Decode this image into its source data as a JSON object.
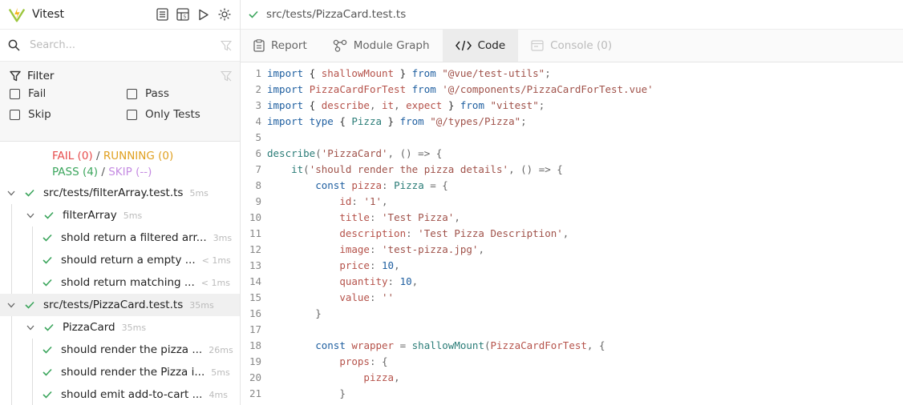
{
  "app": {
    "title": "Vitest"
  },
  "search": {
    "placeholder": "Search..."
  },
  "filter": {
    "title": "Filter",
    "options": [
      "Fail",
      "Pass",
      "Skip",
      "Only Tests"
    ]
  },
  "summary": {
    "fail": "FAIL (0)",
    "running": "RUNNING (0)",
    "pass": "PASS (4)",
    "skip": "SKIP (--)",
    "separator": "/"
  },
  "tree": [
    {
      "label": "src/tests/filterArray.test.ts",
      "duration": "5ms",
      "level": 0,
      "chevron": true
    },
    {
      "label": "filterArray",
      "duration": "5ms",
      "level": 1,
      "chevron": true
    },
    {
      "label": "shold return a filtered arr...",
      "duration": "3ms",
      "level": 2,
      "chevron": false
    },
    {
      "label": "should return a empty ...",
      "duration": "< 1ms",
      "level": 2,
      "chevron": false
    },
    {
      "label": "shold return matching ...",
      "duration": "< 1ms",
      "level": 2,
      "chevron": false
    },
    {
      "label": "src/tests/PizzaCard.test.ts",
      "duration": "35ms",
      "level": 0,
      "chevron": true,
      "active": true
    },
    {
      "label": "PizzaCard",
      "duration": "35ms",
      "level": 1,
      "chevron": true
    },
    {
      "label": "should render the pizza ...",
      "duration": "26ms",
      "level": 2,
      "chevron": false
    },
    {
      "label": "should render the Pizza i...",
      "duration": "5ms",
      "level": 2,
      "chevron": false
    },
    {
      "label": "should emit add-to-cart ...",
      "duration": "4ms",
      "level": 2,
      "chevron": false
    }
  ],
  "file": {
    "path": "src/tests/PizzaCard.test.ts"
  },
  "tabs": [
    {
      "label": "Report",
      "icon": "report-icon",
      "state": "normal"
    },
    {
      "label": "Module Graph",
      "icon": "graph-icon",
      "state": "normal"
    },
    {
      "label": "Code",
      "icon": "code-icon",
      "state": "active"
    },
    {
      "label": "Console (0)",
      "icon": "console-icon",
      "state": "disabled"
    }
  ],
  "code_lines": [
    [
      [
        "kw",
        "import"
      ],
      [
        "plain",
        " { "
      ],
      [
        "var",
        "shallowMount"
      ],
      [
        "plain",
        " } "
      ],
      [
        "kw",
        "from"
      ],
      [
        "plain",
        " "
      ],
      [
        "str",
        "\"@vue/test-utils\""
      ],
      [
        "pun",
        ";"
      ]
    ],
    [
      [
        "kw",
        "import"
      ],
      [
        "plain",
        " "
      ],
      [
        "var",
        "PizzaCardForTest"
      ],
      [
        "plain",
        " "
      ],
      [
        "kw",
        "from"
      ],
      [
        "plain",
        " "
      ],
      [
        "str",
        "'@/components/PizzaCardForTest.vue'"
      ]
    ],
    [
      [
        "kw",
        "import"
      ],
      [
        "plain",
        " { "
      ],
      [
        "var",
        "describe"
      ],
      [
        "pun",
        ", "
      ],
      [
        "var",
        "it"
      ],
      [
        "pun",
        ", "
      ],
      [
        "var",
        "expect"
      ],
      [
        "plain",
        " } "
      ],
      [
        "kw",
        "from"
      ],
      [
        "plain",
        " "
      ],
      [
        "str",
        "\"vitest\""
      ],
      [
        "pun",
        ";"
      ]
    ],
    [
      [
        "kw",
        "import"
      ],
      [
        "plain",
        " "
      ],
      [
        "kw",
        "type"
      ],
      [
        "plain",
        " { "
      ],
      [
        "typ",
        "Pizza"
      ],
      [
        "plain",
        " } "
      ],
      [
        "kw",
        "from"
      ],
      [
        "plain",
        " "
      ],
      [
        "str",
        "\"@/types/Pizza\""
      ],
      [
        "pun",
        ";"
      ]
    ],
    [],
    [
      [
        "fn",
        "describe"
      ],
      [
        "pun",
        "("
      ],
      [
        "str",
        "'PizzaCard'"
      ],
      [
        "pun",
        ", () => {"
      ]
    ],
    [
      [
        "plain",
        "    "
      ],
      [
        "fn",
        "it"
      ],
      [
        "pun",
        "("
      ],
      [
        "str",
        "'should render the pizza details'"
      ],
      [
        "pun",
        ", () => {"
      ]
    ],
    [
      [
        "plain",
        "        "
      ],
      [
        "kw",
        "const"
      ],
      [
        "plain",
        " "
      ],
      [
        "var",
        "pizza"
      ],
      [
        "pun",
        ": "
      ],
      [
        "typ",
        "Pizza"
      ],
      [
        "pun",
        " = {"
      ]
    ],
    [
      [
        "plain",
        "            "
      ],
      [
        "prop",
        "id"
      ],
      [
        "pun",
        ": "
      ],
      [
        "str",
        "'1'"
      ],
      [
        "pun",
        ","
      ]
    ],
    [
      [
        "plain",
        "            "
      ],
      [
        "prop",
        "title"
      ],
      [
        "pun",
        ": "
      ],
      [
        "str",
        "'Test Pizza'"
      ],
      [
        "pun",
        ","
      ]
    ],
    [
      [
        "plain",
        "            "
      ],
      [
        "prop",
        "description"
      ],
      [
        "pun",
        ": "
      ],
      [
        "str",
        "'Test Pizza Description'"
      ],
      [
        "pun",
        ","
      ]
    ],
    [
      [
        "plain",
        "            "
      ],
      [
        "prop",
        "image"
      ],
      [
        "pun",
        ": "
      ],
      [
        "str",
        "'test-pizza.jpg'"
      ],
      [
        "pun",
        ","
      ]
    ],
    [
      [
        "plain",
        "            "
      ],
      [
        "prop",
        "price"
      ],
      [
        "pun",
        ": "
      ],
      [
        "num",
        "10"
      ],
      [
        "pun",
        ","
      ]
    ],
    [
      [
        "plain",
        "            "
      ],
      [
        "prop",
        "quantity"
      ],
      [
        "pun",
        ": "
      ],
      [
        "num",
        "10"
      ],
      [
        "pun",
        ","
      ]
    ],
    [
      [
        "plain",
        "            "
      ],
      [
        "prop",
        "value"
      ],
      [
        "pun",
        ": "
      ],
      [
        "str",
        "''"
      ]
    ],
    [
      [
        "plain",
        "        "
      ],
      [
        "pun",
        "}"
      ]
    ],
    [],
    [
      [
        "plain",
        "        "
      ],
      [
        "kw",
        "const"
      ],
      [
        "plain",
        " "
      ],
      [
        "var",
        "wrapper"
      ],
      [
        "pun",
        " = "
      ],
      [
        "fn",
        "shallowMount"
      ],
      [
        "pun",
        "("
      ],
      [
        "var",
        "PizzaCardForTest"
      ],
      [
        "pun",
        ", {"
      ]
    ],
    [
      [
        "plain",
        "            "
      ],
      [
        "prop",
        "props"
      ],
      [
        "pun",
        ": {"
      ]
    ],
    [
      [
        "plain",
        "                "
      ],
      [
        "var",
        "pizza"
      ],
      [
        "pun",
        ","
      ]
    ],
    [
      [
        "plain",
        "            "
      ],
      [
        "pun",
        "}"
      ]
    ]
  ]
}
